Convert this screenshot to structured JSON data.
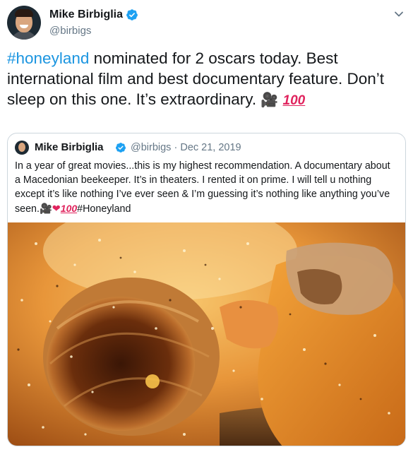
{
  "tweet": {
    "display_name": "Mike Birbiglia",
    "handle": "@birbigs",
    "text_hashtag": "#honeyland",
    "text_body": " nominated for 2 oscars today. Best international film and best documentary feature. Don’t sleep on this one. It’s extraordinary. ",
    "text_emoji_camera": "🎥",
    "text_emoji_hundred": "100"
  },
  "quoted_tweet": {
    "display_name": "Mike Birbiglia",
    "handle": "@birbigs",
    "separator": "·",
    "date": "Dec 21, 2019",
    "text": "In a year of great movies...this is my highest recommendation. A documentary about a Macedonian beekeeper. It’s in theaters. I rented it on prime. I will tell u nothing except it’s like nothing I’ve ever seen & I’m guessing it’s nothing like anything you’ve seen.",
    "emoji_camera": "🎥",
    "emoji_heart": "❤",
    "emoji_hundred": "100",
    "hashtag": "#Honeyland"
  },
  "icons": {
    "verified": "verified-badge-icon",
    "menu": "chevron-down-icon",
    "avatar": "profile-avatar"
  },
  "colors": {
    "link_blue": "#1b95e0",
    "verified_blue": "#1da1f2",
    "secondary_text": "#657786",
    "border": "#ccd6dd"
  }
}
